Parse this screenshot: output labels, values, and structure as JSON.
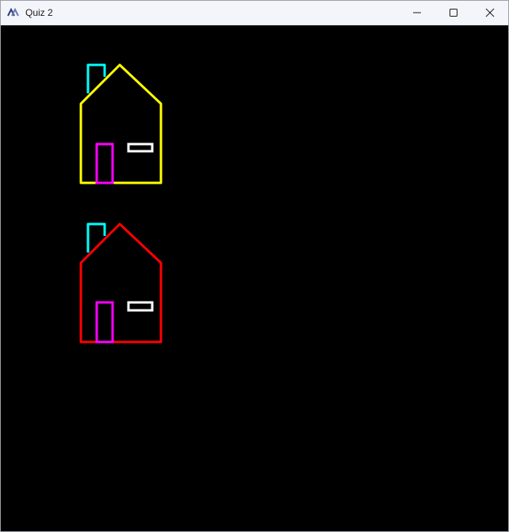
{
  "window": {
    "title": "Quiz 2"
  },
  "icons": {
    "app": "app-logo-icon",
    "minimize": "minimize-icon",
    "maximize": "maximize-icon",
    "close": "close-icon"
  },
  "colors": {
    "canvas_background": "#000000",
    "titlebar_background": "#f3f5fb",
    "house_1_outline": "#ffff00",
    "house_2_outline": "#ff0000",
    "chimney": "#00ffff",
    "door": "#ff00ff",
    "window": "#ffffff"
  }
}
